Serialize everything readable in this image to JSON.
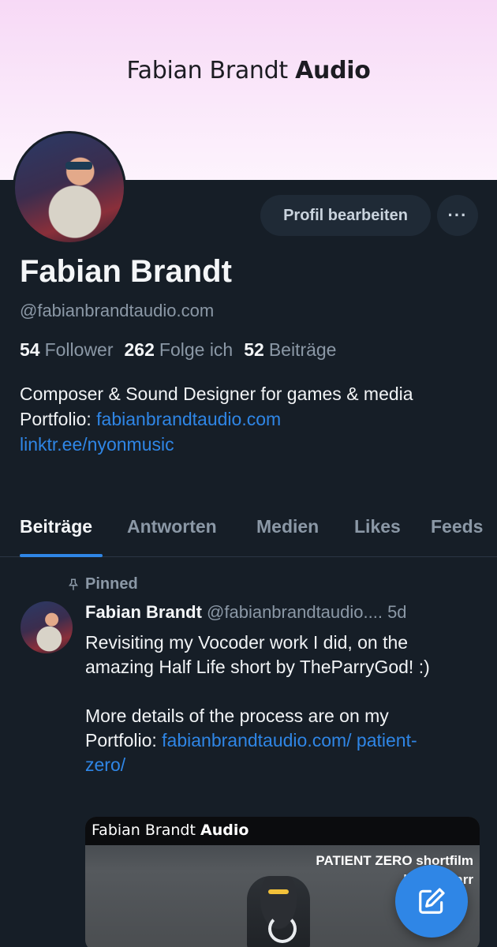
{
  "banner": {
    "brand_light": "Fabian Brandt",
    "brand_bold": "Audio"
  },
  "profile": {
    "display_name": "Fabian Brandt",
    "handle": "@fabianbrandtaudio.com",
    "edit_button": "Profil bearbeiten",
    "more_button": "···",
    "stats": {
      "followers_count": "54",
      "followers_label": "Follower",
      "following_count": "262",
      "following_label": "Folge ich",
      "posts_count": "52",
      "posts_label": "Beiträge"
    },
    "bio": {
      "line1": "Composer & Sound Designer for games & media",
      "portfolio_prefix": "Portfolio: ",
      "portfolio_link": "fabianbrandtaudio.com",
      "linktree": "linktr.ee/nyonmusic"
    }
  },
  "tabs": [
    {
      "label": "Beiträge",
      "active": true
    },
    {
      "label": "Antworten"
    },
    {
      "label": "Medien"
    },
    {
      "label": "Likes"
    },
    {
      "label": "Feeds"
    }
  ],
  "post": {
    "pinned_label": "Pinned",
    "author": "Fabian Brandt",
    "meta": "@fabianbrandtaudio.... 5d",
    "paragraph1": "Revisiting my Vocoder work I did, on the amazing Half Life short by TheParryGod! :)",
    "paragraph2_prefix": "More details of the process are on my Portfolio: ",
    "paragraph2_link": "fabianbrandtaudio.com/ patient-zero/",
    "embed": {
      "title_light": "Fabian Brandt",
      "title_bold": "Audio",
      "caption_line1": "PATIENT ZERO shortfilm",
      "caption_line2": "by TheParr"
    }
  },
  "colors": {
    "accent": "#2f86e6",
    "background": "#161e27",
    "muted": "#8b98a6"
  },
  "icons": {
    "more": "ellipsis-icon",
    "pin": "pin-icon",
    "compose": "compose-icon"
  }
}
